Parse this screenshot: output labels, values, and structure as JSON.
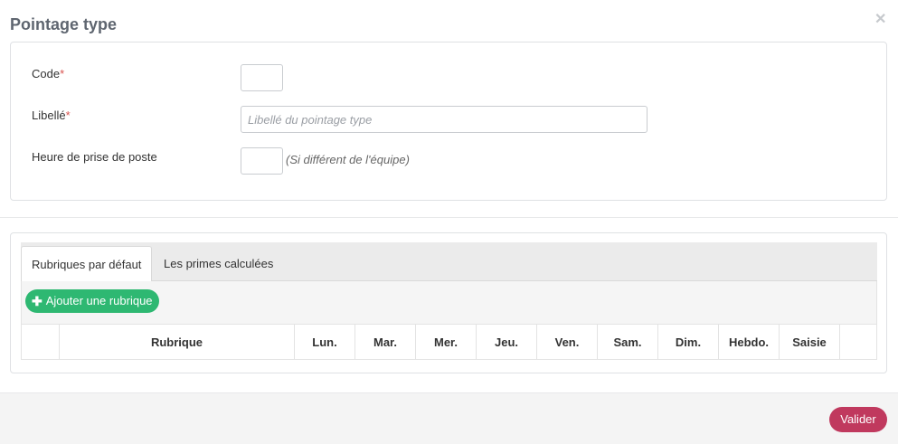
{
  "modal": {
    "title": "Pointage type",
    "close_icon": "close-icon"
  },
  "form": {
    "code_label": "Code",
    "libelle_label": "Libellé",
    "required_mark": "*",
    "libelle_placeholder": "Libellé du pointage type",
    "heure_label": "Heure de prise de poste",
    "heure_hint": "(Si différent de l'équipe)"
  },
  "tabs": [
    {
      "label": "Rubriques par défaut",
      "active": true
    },
    {
      "label": "Les primes calculées",
      "active": false
    }
  ],
  "toolbar": {
    "add_label": "Ajouter une rubrique",
    "add_icon": "plus-icon"
  },
  "table": {
    "columns": [
      "",
      "Rubrique",
      "Lun.",
      "Mar.",
      "Mer.",
      "Jeu.",
      "Ven.",
      "Sam.",
      "Dim.",
      "Hebdo.",
      "Saisie",
      ""
    ]
  },
  "footer": {
    "submit_label": "Valider"
  },
  "colors": {
    "add_button": "#2eb872",
    "submit_button": "#c0395e",
    "required": "#d9534f"
  }
}
